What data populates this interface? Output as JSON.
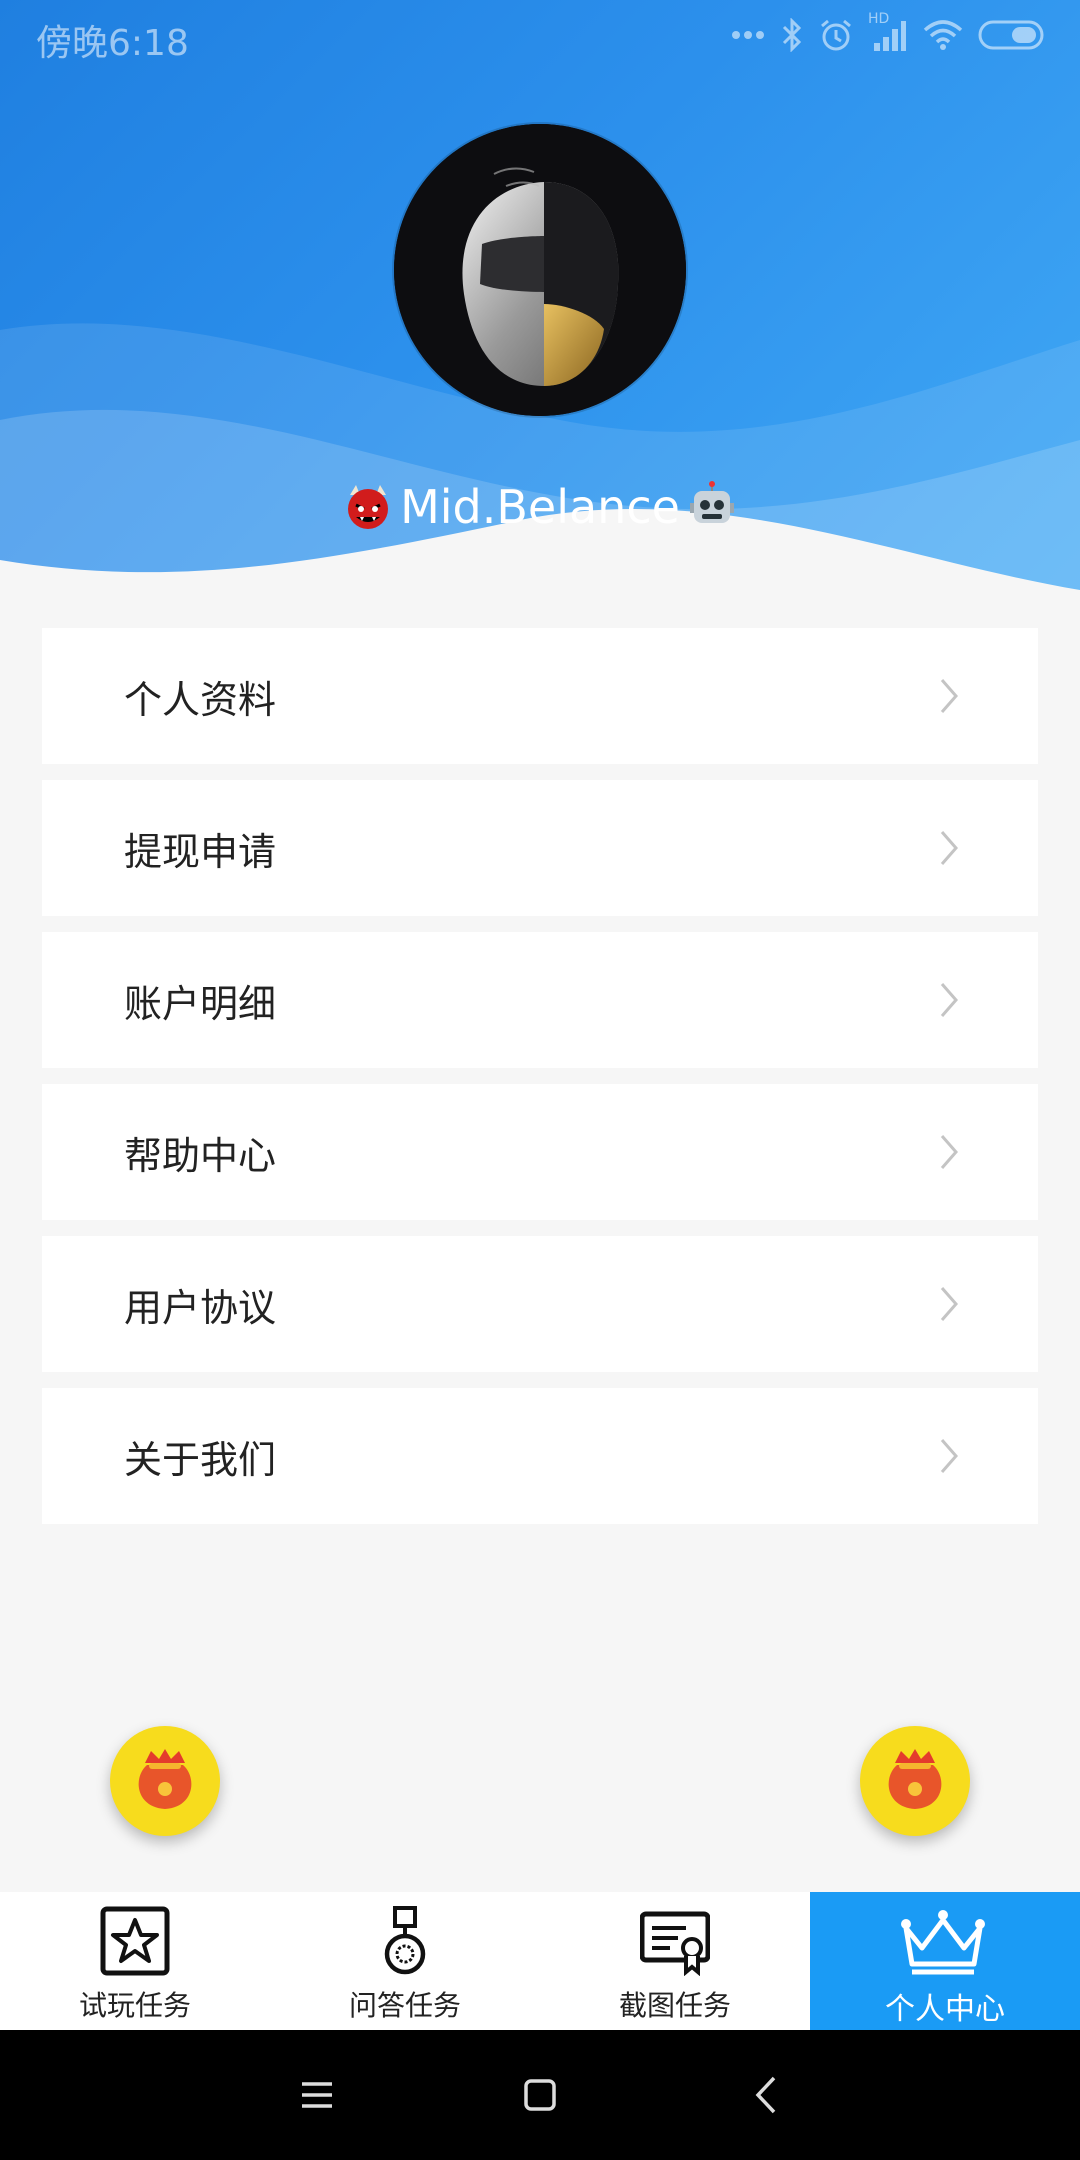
{
  "status_bar": {
    "time": "傍晚6:18",
    "network_label": "HD"
  },
  "profile": {
    "username": "Mid.Belance",
    "avatar": "helmet-avatar",
    "emoji_left": "ogre-emoji",
    "emoji_right": "robot-emoji"
  },
  "menu": {
    "items": [
      {
        "label": "个人资料"
      },
      {
        "label": "提现申请"
      },
      {
        "label": "账户明细"
      },
      {
        "label": "帮助中心"
      },
      {
        "label": "用户协议"
      },
      {
        "label": "关于我们"
      }
    ]
  },
  "tabs": [
    {
      "label": "试玩任务",
      "icon": "star-frame-icon",
      "active": false
    },
    {
      "label": "问答任务",
      "icon": "medal-icon",
      "active": false
    },
    {
      "label": "截图任务",
      "icon": "certificate-icon",
      "active": false
    },
    {
      "label": "个人中心",
      "icon": "crown-icon",
      "active": true
    }
  ],
  "colors": {
    "header_blue": "#2c90ec",
    "active_tab": "#1a9bf5",
    "fab_yellow": "#f7dc1d"
  }
}
